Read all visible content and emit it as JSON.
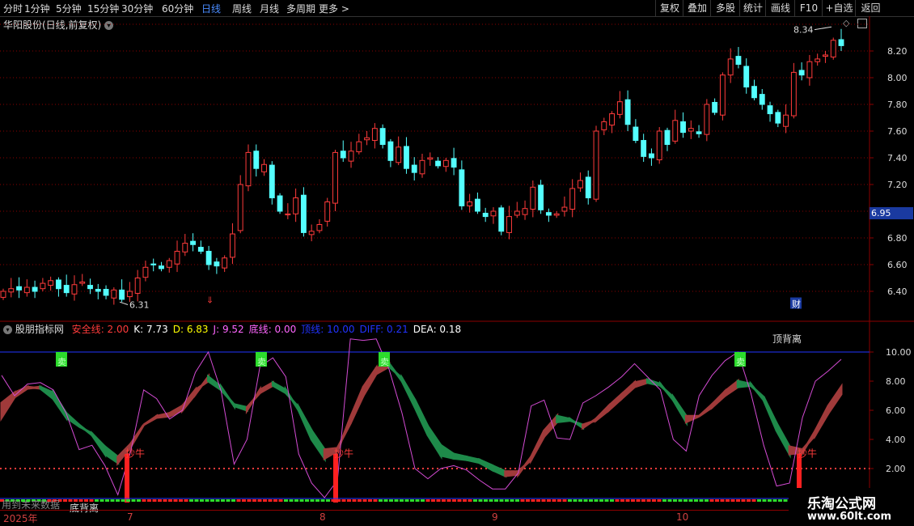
{
  "toolbar": {
    "periods": [
      "分时",
      "1分钟",
      "5分钟",
      "15分钟",
      "30分钟",
      "60分钟",
      "日线",
      "周线",
      "月线",
      "多周期",
      "更多 >"
    ],
    "active_period": "日线",
    "buttons": [
      "复权",
      "叠加",
      "多股",
      "统计",
      "画线",
      "F10",
      "+自选",
      "返回"
    ]
  },
  "main_pane": {
    "title": "华阳股份(日线,前复权)",
    "high_label": "8.34",
    "low_label": "6.31",
    "current_price": "6.95",
    "price_ticks": [
      "8.20",
      "8.00",
      "7.80",
      "7.60",
      "7.40",
      "7.20",
      "6.80",
      "6.60",
      "6.40"
    ],
    "markers": [
      "⇓",
      "财"
    ],
    "colors": {
      "up": "#ff3b3b",
      "down": "#54ffff",
      "grid": "#8b0000"
    }
  },
  "indicator_pane": {
    "title": "股朋指标网",
    "values": [
      {
        "label": "安全线",
        "value": "2.00",
        "color": "#ff3b3b"
      },
      {
        "label": "K",
        "value": "7.73",
        "color": "#ffffff"
      },
      {
        "label": "D",
        "value": "6.83",
        "color": "#ffff00"
      },
      {
        "label": "J",
        "value": "9.52",
        "color": "#ff66ff"
      },
      {
        "label": "底线",
        "value": "0.00",
        "color": "#ff66ff"
      },
      {
        "label": "顶线",
        "value": "10.00",
        "color": "#2233ff"
      },
      {
        "label": "DIFF",
        "value": "0.21",
        "color": "#2233ff"
      },
      {
        "label": "DEA",
        "value": "0.18",
        "color": "#ffffff"
      }
    ],
    "ticks": [
      "10.00",
      "8.00",
      "6.00",
      "4.00",
      "2.00"
    ],
    "signal_buy": "抄牛",
    "signal_sell": "卖",
    "top_divergence": "顶背离",
    "bottom_divergence": "底背离",
    "future_data_note": "用到未来数据"
  },
  "date_axis": {
    "year": "2025年",
    "months": [
      "7",
      "8",
      "9",
      "10"
    ]
  },
  "watermark": {
    "name": "乐淘公式网",
    "url": "www.60lt.com"
  }
}
